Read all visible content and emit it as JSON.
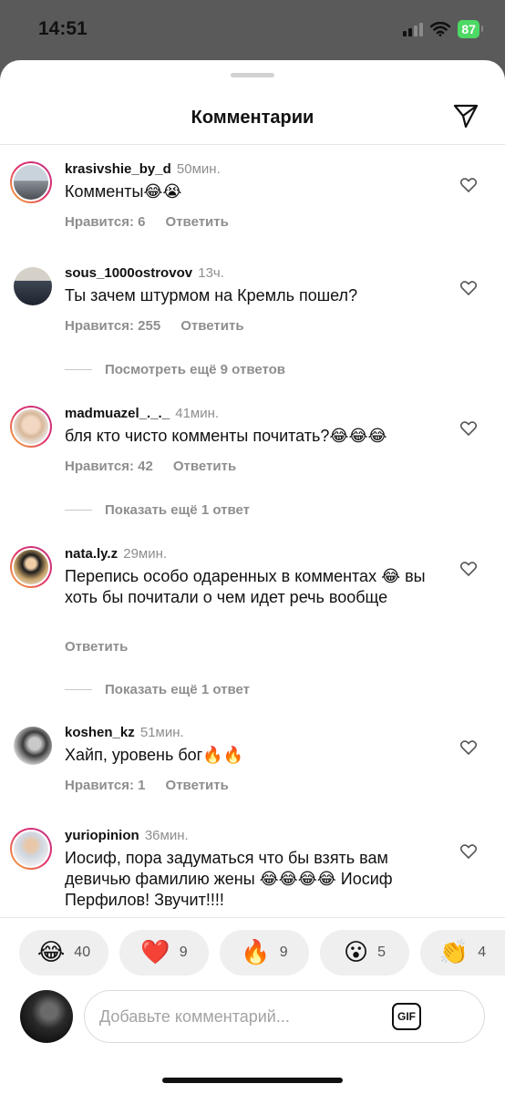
{
  "status_bar": {
    "time": "14:51",
    "battery": "87"
  },
  "header": {
    "title": "Комментарии"
  },
  "comments": [
    {
      "username": "krasivshie_by_d",
      "time": "50мин.",
      "text": "Комменты😂😭",
      "likes": "Нравится: 6",
      "reply": "Ответить"
    },
    {
      "username": "sous_1000ostrovov",
      "time": "13ч.",
      "text": "Ты зачем штурмом на Кремль пошел?",
      "likes": "Нравится: 255",
      "reply": "Ответить"
    },
    {
      "username": "madmuazel_._._",
      "time": "41мин.",
      "text": "бля кто чисто комменты почитать?😂😂😂",
      "likes": "Нравится: 42",
      "reply": "Ответить"
    },
    {
      "username": "nata.ly.z",
      "time": "29мин.",
      "text": "Перепись особо одаренных в комментах 😂 вы хоть бы почитали о чем идет речь вообще",
      "likes": "",
      "reply": "Ответить"
    },
    {
      "username": "koshen_kz",
      "time": "51мин.",
      "text": "Хайп, уровень бог🔥🔥",
      "likes": "Нравится: 1",
      "reply": "Ответить"
    },
    {
      "username": "yuriopinion",
      "time": "36мин.",
      "text": "Иосиф, пора задуматься что бы взять вам девичью фамилию жены 😂😂😂😂 Иосиф Перфилов! Звучит!!!!",
      "likes": "",
      "reply": ""
    }
  ],
  "more_replies": [
    "Посмотреть ещё 9 ответов",
    "Показать ещё 1 ответ",
    "Показать ещё 1 ответ"
  ],
  "reactions": [
    {
      "emoji": "😂",
      "count": "40"
    },
    {
      "emoji": "❤️",
      "count": "9"
    },
    {
      "emoji": "🔥",
      "count": "9"
    },
    {
      "emoji": "😮",
      "count": "5"
    },
    {
      "emoji": "👏",
      "count": "4"
    }
  ],
  "composer": {
    "placeholder": "Добавьте комментарий...",
    "gif_label": "GIF"
  },
  "colors": {
    "ring_start": "#f7b733",
    "ring_end": "#c13584",
    "muted_text": "#8e8e8e",
    "battery": "#4cd964"
  },
  "icons": [
    "send-icon",
    "heart-icon",
    "gif-icon",
    "signal-icon",
    "wifi-icon",
    "battery-icon"
  ]
}
